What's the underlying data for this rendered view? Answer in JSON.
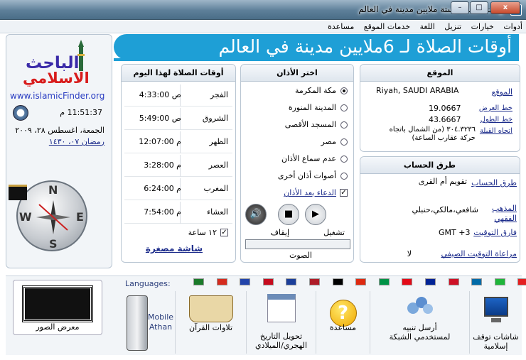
{
  "window": {
    "title": "أوقات الصلاة لستة ملايين مدينة في العالم",
    "controls": {
      "minimize": "–",
      "maximize": "□",
      "close": "x"
    }
  },
  "menu": [
    "أدوات",
    "خيارات",
    "تنزيل",
    "اللغة",
    "خدمات الموقع",
    "مساعدة"
  ],
  "banner": {
    "text": "أوقات الصلاة لـ 6ملايين مدينة في العالم"
  },
  "brand": {
    "logo_line1": "الباحث",
    "logo_line2": "الاسلامي",
    "url": "www.islamicFinder.org"
  },
  "clock": {
    "time": "11:51:37 م",
    "date_gregorian": "الجمعة، اغسطس ٢٨، ٢٠٠٩",
    "date_hijri": "رمضان ٠٧، ١٤٣٠"
  },
  "compass": {
    "n": "N",
    "s": "S",
    "e": "E",
    "w": "W"
  },
  "prayer_times": {
    "title": "أوقات الصلاة لهذا اليوم",
    "rows": [
      {
        "name": "الفجر",
        "time": "ص 4:33:00"
      },
      {
        "name": "الشروق",
        "time": "ص 5:49:00"
      },
      {
        "name": "الظهر",
        "time": "م 12:07:00"
      },
      {
        "name": "العصر",
        "time": "م 3:28:00"
      },
      {
        "name": "المغرب",
        "time": "م 6:24:00"
      },
      {
        "name": "العشاء",
        "time": "م 7:54:00"
      }
    ],
    "hour12_label": "١٢ ساعة",
    "mini_screen_link": "شاشة مصغرة"
  },
  "adhan": {
    "title": "اختر الأذان",
    "options": [
      "مكة المكرمة",
      "المدينة المنورة",
      "المسجد الأقصى",
      "مصر",
      "عدم سماع الأذان",
      "أصوات أذان أخرى"
    ],
    "selected_index": 0,
    "dua_label": "الدعاء بعد الأذان",
    "play_label": "تشغيل",
    "stop_label": "إيقاف",
    "volume_label": "الصوت"
  },
  "location": {
    "title": "الموقع",
    "location_label": "الموقع",
    "location_value": "Riyah, SAUDI ARABIA",
    "lat_label": "خط العرض",
    "lat_value": "19.0667",
    "lon_label": "خط الطول",
    "lon_value": "43.6667",
    "qibla_label": "اتجاه القبلة",
    "qibla_value": "٣٠٤.٣٢٣٦ (من الشمال باتجاه حركة عقارب الساعة)"
  },
  "calc": {
    "title": "طرق الحساب",
    "method_label": "طرق الحساب",
    "method_value": "تقويم أم القرى",
    "madhab_label": "المذهب الفقهي",
    "madhab_value": "شافعي،مالكي،حنبلي",
    "tz_label": "فارق التوقيت",
    "tz_value": "GMT +3",
    "dst_label": "مراعاة التوقيت الصيفي",
    "dst_value": "لا"
  },
  "languages": {
    "label": "Languages:",
    "flags": [
      {
        "name": "saudi",
        "color": "#1a7a2a"
      },
      {
        "name": "canada",
        "color": "#d52b1e"
      },
      {
        "name": "france",
        "color": "#2244aa"
      },
      {
        "name": "spain",
        "color": "#c60b1e"
      },
      {
        "name": "russia",
        "color": "#1c3f9a"
      },
      {
        "name": "netherlands",
        "color": "#ae1c28"
      },
      {
        "name": "germany",
        "color": "#000000"
      },
      {
        "name": "china",
        "color": "#de2910"
      },
      {
        "name": "italy",
        "color": "#009246"
      },
      {
        "name": "turkey",
        "color": "#e30a17"
      },
      {
        "name": "bosnia",
        "color": "#002395"
      },
      {
        "name": "indonesia",
        "color": "#ce1126"
      },
      {
        "name": "sweden",
        "color": "#006aa7"
      },
      {
        "name": "uzbekistan",
        "color": "#1eb53a"
      },
      {
        "name": "albania",
        "color": "#e41e20"
      }
    ]
  },
  "bottom": {
    "gallery": "معرض الصور",
    "mobile_line1": "Mobile",
    "mobile_line2": "Athan",
    "quran": "تلاوات القرآن",
    "convert_line1": "تحويل التاريخ",
    "convert_line2": "الهجري/الميلادي",
    "help": "مساعدة",
    "network_line1": "أرسل تنبيه",
    "network_line2": "لمستخدمي الشبكة",
    "screensaver_line1": "شاشات توقف",
    "screensaver_line2": "إسلامية"
  }
}
